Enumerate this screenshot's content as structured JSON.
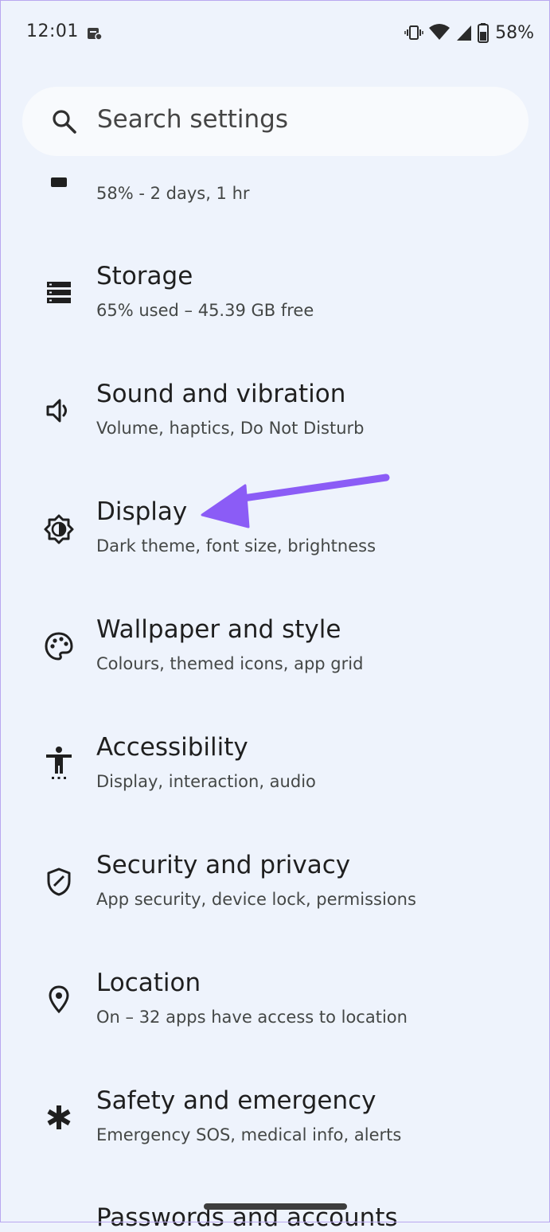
{
  "status_bar": {
    "time": "12:01",
    "battery_percent": "58%",
    "icons": [
      "notification-icon",
      "vibrate-icon",
      "wifi-icon",
      "cellular-icon",
      "battery-icon"
    ]
  },
  "search": {
    "placeholder": "Search settings",
    "icon": "search-icon"
  },
  "settings": {
    "battery": {
      "subtitle": "58% - 2 days, 1 hr",
      "icon": "battery-icon"
    },
    "items": [
      {
        "title": "Storage",
        "subtitle": "65% used – 45.39 GB free",
        "icon": "storage-icon"
      },
      {
        "title": "Sound and vibration",
        "subtitle": "Volume, haptics, Do Not Disturb",
        "icon": "speaker-icon"
      },
      {
        "title": "Display",
        "subtitle": "Dark theme, font size, brightness",
        "icon": "brightness-icon"
      },
      {
        "title": "Wallpaper and style",
        "subtitle": "Colours, themed icons, app grid",
        "icon": "palette-icon"
      },
      {
        "title": "Accessibility",
        "subtitle": "Display, interaction, audio",
        "icon": "accessibility-icon"
      },
      {
        "title": "Security and privacy",
        "subtitle": "App security, device lock, permissions",
        "icon": "shield-icon"
      },
      {
        "title": "Location",
        "subtitle": "On – 32 apps have access to location",
        "icon": "location-pin-icon"
      },
      {
        "title": "Safety and emergency",
        "subtitle": "Emergency SOS, medical info, alerts",
        "icon": "asterisk-icon"
      }
    ],
    "cut_off_title": "Passwords and accounts"
  },
  "colors": {
    "background": "#eef3fc",
    "search_bg": "#f8fafd",
    "annotation_arrow": "#8b5cf6"
  }
}
